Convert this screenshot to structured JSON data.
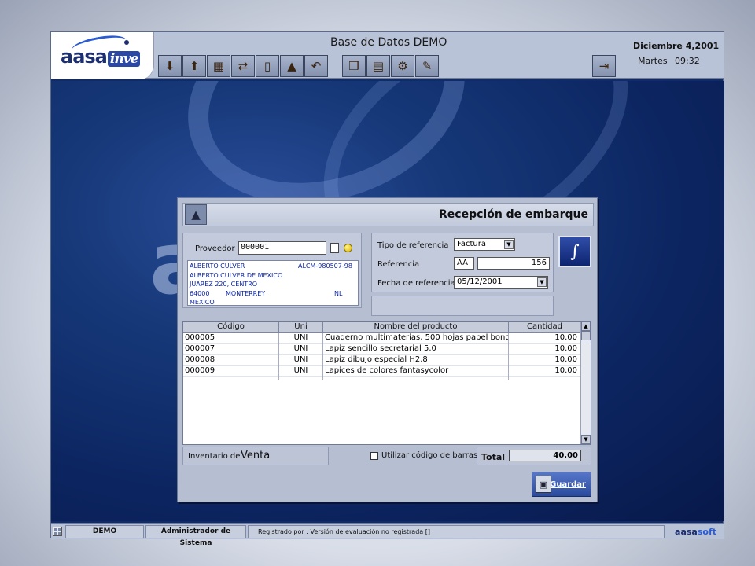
{
  "app": {
    "logo_text": "aasa",
    "logo_sub": "inve",
    "db_title": "Base de Datos DEMO",
    "date": "Diciembre 4,2001",
    "day": "Martes",
    "time": "09:32"
  },
  "toolbar": {
    "buttons": [
      {
        "icon": "box-down-icon",
        "glyph": "⬇"
      },
      {
        "icon": "box-up-icon",
        "glyph": "⬆"
      },
      {
        "icon": "boxes-icon",
        "glyph": "▦"
      },
      {
        "icon": "transfer-icon",
        "glyph": "⇄"
      },
      {
        "icon": "document-icon",
        "glyph": "▯"
      },
      {
        "icon": "pyramid-icon",
        "glyph": "▲"
      },
      {
        "icon": "return-icon",
        "glyph": "↶"
      },
      {
        "icon": "books-icon",
        "glyph": "❒"
      },
      {
        "icon": "catalog-icon",
        "glyph": "▤"
      },
      {
        "icon": "gears-icon",
        "glyph": "⚙"
      },
      {
        "icon": "tools-icon",
        "glyph": "✎"
      }
    ],
    "exit_glyph": "⇥"
  },
  "dialog": {
    "title": "Recepción de embarque",
    "icon_glyph": "▲",
    "proveedor_label": "Proveedor",
    "proveedor_value": "000001",
    "address": {
      "name": "ALBERTO CULVER",
      "rfc": "ALCM-980507-98",
      "company": "ALBERTO CULVER DE MEXICO",
      "street": "JUAREZ 220, CENTRO",
      "zip": "64000",
      "city": "MONTERREY",
      "state": "NL",
      "country": "MEXICO"
    },
    "tipo_ref_label": "Tipo de referencia",
    "tipo_ref_value": "Factura",
    "ref_label": "Referencia",
    "ref_prefix": "AA",
    "ref_number": "156",
    "fecha_ref_label": "Fecha de referencia",
    "fecha_ref_value": "05/12/2001",
    "grid": {
      "headers": [
        "Código",
        "Uni",
        "Nombre del producto",
        "Cantidad"
      ],
      "rows": [
        {
          "code": "000005",
          "unit": "UNI",
          "name": "Cuaderno multimaterias, 500 hojas papel bond,",
          "qty": "10.00"
        },
        {
          "code": "000007",
          "unit": "UNI",
          "name": "Lapiz sencillo secretarial 5.0",
          "qty": "10.00"
        },
        {
          "code": "000008",
          "unit": "UNI",
          "name": "Lapiz dibujo especial H2.8",
          "qty": "10.00"
        },
        {
          "code": "000009",
          "unit": "UNI",
          "name": "Lapices de colores fantasycolor",
          "qty": "10.00"
        }
      ]
    },
    "inventario_label": "Inventario de",
    "inventario_value": "Venta",
    "barcode_label": "Utilizar código de barras",
    "total_label": "Total",
    "total_value": "40.00",
    "save_label": "Guardar"
  },
  "statusbar": {
    "db": "DEMO",
    "user": "Administrador de Sistema",
    "registered": "Registrado por : Versión de evaluación no registrada  []",
    "brand_a": "aasa",
    "brand_b": "soft"
  },
  "colors": {
    "desktop_blue": "#0e2c6d",
    "panel": "#b6bfd2",
    "address_text": "#0a24a8"
  }
}
